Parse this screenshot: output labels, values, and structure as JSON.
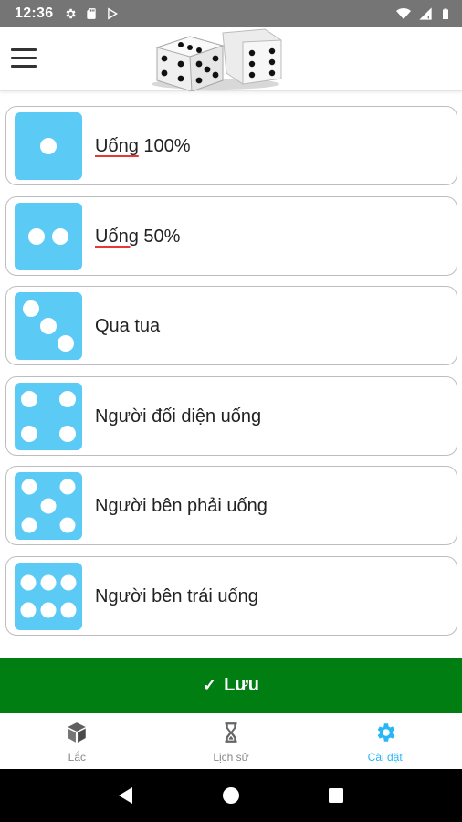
{
  "status_bar": {
    "time": "12:36",
    "left_icons": [
      "gear-icon",
      "sd-card-icon",
      "play-store-icon"
    ],
    "right_icons": [
      "wifi-icon",
      "signal-icon",
      "battery-icon"
    ]
  },
  "app_bar": {
    "menu_icon": "hamburger-menu-icon",
    "logo": "dice-logo"
  },
  "options": [
    {
      "face": 1,
      "label_prefix": "Uống",
      "label_rest": " 100%"
    },
    {
      "face": 2,
      "label_prefix": "Uống",
      "label_rest": " 50%"
    },
    {
      "face": 3,
      "label_prefix": "",
      "label_rest": "Qua tua"
    },
    {
      "face": 4,
      "label_prefix": "",
      "label_rest": "Người đối diện uống"
    },
    {
      "face": 5,
      "label_prefix": "",
      "label_rest": "Người bên phải uống"
    },
    {
      "face": 6,
      "label_prefix": "",
      "label_rest": "Người bên trái uống"
    }
  ],
  "save_button": {
    "check": "✓",
    "label": "Lưu"
  },
  "bottom_nav": [
    {
      "label": "Lắc",
      "icon": "cube-icon",
      "active": false
    },
    {
      "label": "Lịch sử",
      "icon": "hourglass-icon",
      "active": false
    },
    {
      "label": "Cài đặt",
      "icon": "gear-icon",
      "active": true
    }
  ],
  "colors": {
    "die_face": "#5bcbf5",
    "save_button": "#007e12",
    "active_tab": "#29b6f6",
    "status_bar": "#757575"
  }
}
